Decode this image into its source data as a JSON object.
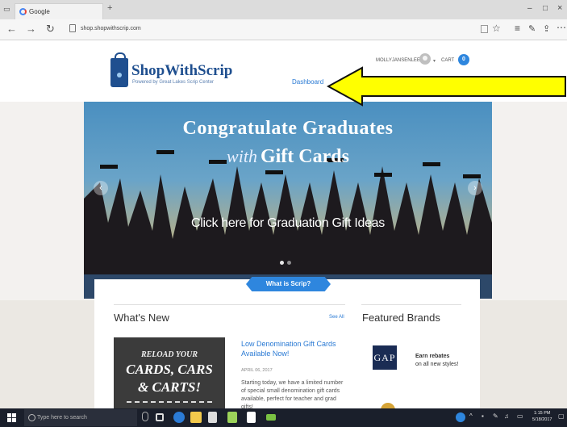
{
  "browser": {
    "tab_title": "Google",
    "new_tab": "+",
    "url": "shop.shopwithscrip.com",
    "nav": {
      "back": "←",
      "forward": "→",
      "refresh": "↻"
    },
    "window_controls": {
      "minimize": "–",
      "maximize": "□",
      "close": "×"
    }
  },
  "header": {
    "logo_title": "ShopWithScrip",
    "logo_subtitle": "Powered by Great Lakes Scrip Center",
    "username": "MOLLYJANSENLEE",
    "cart_label": "CART",
    "cart_count": "0",
    "dashboard_link": "Dashboard"
  },
  "hero": {
    "title": "Congratulate Graduates",
    "subtitle_script": "with",
    "subtitle": "Gift Cards",
    "cta": "Click here for Graduation Gift Ideas",
    "prev": "‹",
    "next": "›"
  },
  "scrip_button": "What is Scrip?",
  "whats_new": {
    "heading": "What's New",
    "see_all": "See All",
    "image_lines": [
      "RELOAD YOUR",
      "CARDS, CARS",
      "& CARTS!"
    ],
    "item_title": "Low Denomination Gift Cards Available Now!",
    "item_date": "APRIL 06, 2017",
    "item_body": "Starting today, we have a limited number of special small denomination gift cards available, perfect for teacher and grad gifts!"
  },
  "featured": {
    "heading": "Featured Brands",
    "brand": "GAP",
    "rebate_title": "Earn rebates",
    "rebate_sub": "on all new styles!"
  },
  "taskbar": {
    "search_placeholder": "Type here to search",
    "time": "1:15 PM",
    "date": "5/18/2017"
  },
  "colors": {
    "accent": "#2e86de",
    "brand": "#1f4f8f",
    "arrow": "#ffff00",
    "taskbar": "#1a1f2b"
  }
}
